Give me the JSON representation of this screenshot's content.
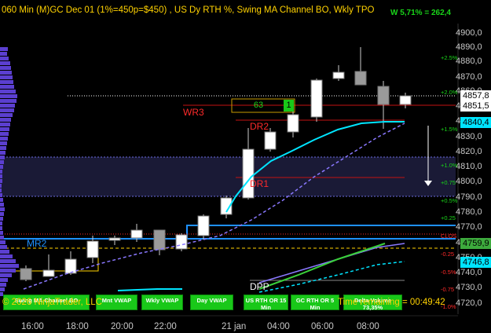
{
  "header": {
    "title": "060 Min  (M)GC Dec 01 (1%=450p=$450) , US Dy RTH %, Swing MA Channel BO, Wkly TPO",
    "weekly_pct": "W 5,71% = 262,4"
  },
  "price_axis": [
    "4900,0",
    "4890,0",
    "4880,0",
    "4870,0",
    "4860,0",
    "4850,0",
    "4840,0",
    "4830,0",
    "4820,0",
    "4810,0",
    "4800,0",
    "4790,0",
    "4780,0",
    "4770,0",
    "4760,0",
    "4750,0",
    "4740,0",
    "4730,0",
    "4720,0"
  ],
  "price_tags": [
    {
      "label": "4857,8",
      "bg": "#ffffff"
    },
    {
      "label": "4851,5",
      "bg": "#ffffff"
    },
    {
      "label": "4840,4",
      "bg": "#00e5ff"
    },
    {
      "label": "4759,9",
      "bg": "#3daa3d"
    },
    {
      "label": "4746,8",
      "bg": "#00e5ff"
    }
  ],
  "pct_labels": [
    {
      "text": "+2.5%",
      "color": "#19d519"
    },
    {
      "text": "+2.0%",
      "color": "#19d519"
    },
    {
      "text": "+1.5%",
      "color": "#19d519"
    },
    {
      "text": "+1.0%",
      "color": "#19d519"
    },
    {
      "text": "+0.75",
      "color": "#19d519"
    },
    {
      "text": "+0.5%",
      "color": "#19d519"
    },
    {
      "text": "+0.25",
      "color": "#19d519"
    },
    {
      "text": "CLOS",
      "color": "#ff2a2a"
    },
    {
      "text": "-0.25",
      "color": "#ff2a2a"
    },
    {
      "text": "-0.5%",
      "color": "#ff2a2a"
    },
    {
      "text": "-0.75",
      "color": "#ff2a2a"
    },
    {
      "text": "-1.0%",
      "color": "#ff2a2a"
    }
  ],
  "levels": {
    "wr3": "WR3",
    "dr2": "DR2",
    "dr1": "DR1",
    "mr2": "MR2",
    "dpp": "DPP"
  },
  "tpo_box": {
    "value": "63",
    "count": "1"
  },
  "time_axis": [
    "16:00",
    "18:00",
    "20:00",
    "22:00",
    "21 jan",
    "04:00",
    "06:00",
    "08:00"
  ],
  "buttons": [
    {
      "l1": "Swing MA Channel BO",
      "l2": ""
    },
    {
      "l1": "Mnt VWAP",
      "l2": ""
    },
    {
      "l1": "Wkly VWAP",
      "l2": ""
    },
    {
      "l1": "Day VWAP",
      "l2": ""
    },
    {
      "l1": "US RTH OR 15",
      "l2": "Min"
    },
    {
      "l1": "GC RTH OR 5",
      "l2": "Min"
    },
    {
      "l1": "Delta Volume",
      "l2": "73,35%"
    }
  ],
  "footer": {
    "copyright": "© 2026 NinjaTrader, LLC",
    "time_remaining": "Time remaining = 00:49:42"
  },
  "colors": {
    "bull": "#ffffff",
    "bear": "#9a9a9a",
    "profile": "#5b3fd0",
    "cyan": "#00e5ff",
    "accent": "#ffd200"
  }
}
